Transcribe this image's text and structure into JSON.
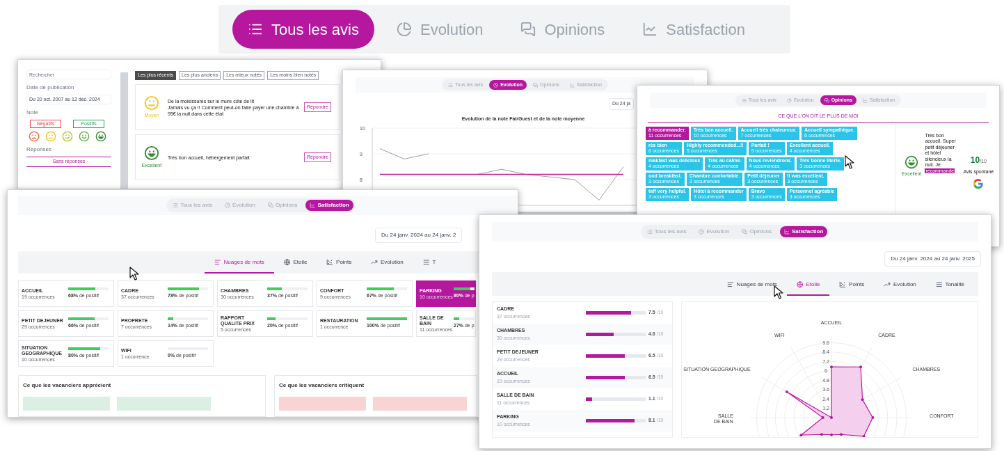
{
  "main_tabs": [
    {
      "label": "Tous les avis",
      "selected": true
    },
    {
      "label": "Evolution",
      "selected": false
    },
    {
      "label": "Opinions",
      "selected": false
    },
    {
      "label": "Satisfaction",
      "selected": false
    }
  ],
  "reviews_window": {
    "search": {
      "placeholder": "Rechercher"
    },
    "date_filter": {
      "label": "Date de publication",
      "value": "Du 20 oct. 2007 au 12 déc. 2024"
    },
    "note_filter": {
      "label": "Note",
      "buttons": [
        {
          "label": "Négatifs",
          "color": "#ef4444"
        },
        {
          "label": "Positifs",
          "color": "#22a55a"
        }
      ],
      "moods": [
        {
          "kind": "sad",
          "color": "#f26b3a"
        },
        {
          "kind": "neutral",
          "color": "#f5c518"
        },
        {
          "kind": "slight",
          "color": "#a8c62a"
        },
        {
          "kind": "smile",
          "color": "#5fae3c"
        },
        {
          "kind": "laugh",
          "color": "#2e8b2e"
        }
      ]
    },
    "responses_filter": {
      "label": "Réponses",
      "option": "Sans réponses"
    },
    "sort_buttons": [
      {
        "label": "Les plus récents",
        "selected": true
      },
      {
        "label": "Les plus anciens",
        "selected": false
      },
      {
        "label": "Les mieux notés",
        "selected": false
      },
      {
        "label": "Les moins bien notés",
        "selected": false
      }
    ],
    "reviews": [
      {
        "kind": "neutral",
        "color": "#f5c518",
        "rating": "Moyen",
        "text": "De la moisissures sur le mure côte de lit\nJamais vu ça !! Comment peut-on faire payer une chambre à 95€ la nuit dans cette état",
        "reply": "Répondre"
      },
      {
        "kind": "laugh",
        "color": "#2e8b2e",
        "rating": "Excellent",
        "text": "Très bon accueil, hébergement parfait",
        "reply": "Répondre"
      }
    ]
  },
  "evolution_window": {
    "tabs": [
      {
        "label": "Tous les avis",
        "selected": false
      },
      {
        "label": "Evolution",
        "selected": true
      },
      {
        "label": "Opinions",
        "selected": false
      },
      {
        "label": "Satisfaction",
        "selected": false
      }
    ],
    "date": "Du 24 ja",
    "chart_data": {
      "type": "line",
      "title": "Evolution de la note FairGuest et de la note moyenne",
      "ylim": [
        7,
        10
      ],
      "yticks": [
        8,
        9,
        10
      ],
      "series": [
        {
          "color": "#9e9e9e",
          "values": [
            9.2,
            8.8,
            9,
            null,
            8.2,
            8.4,
            8.2,
            8.1,
            8.0,
            7.2,
            8.5
          ]
        },
        {
          "color": "#c2189f",
          "values": [
            8.2,
            8.2,
            8.2,
            8.2,
            8.2,
            8.2,
            8.2,
            8.2,
            8.2,
            8.2,
            8.2
          ]
        }
      ]
    }
  },
  "opinions_window": {
    "tabs": [
      {
        "label": "Tous les avis",
        "selected": false
      },
      {
        "label": "Evolution",
        "selected": false
      },
      {
        "label": "Opinions",
        "selected": true
      },
      {
        "label": "Satisfaction",
        "selected": false
      }
    ],
    "heading": "CE QUE L'ON DIT LE PLUS DE MOI",
    "tag_rows": [
      [
        {
          "label": "à recommander.",
          "count": "11 occurrences",
          "selected": true
        },
        {
          "label": "Très bon accueil.",
          "count": "10 occurrences",
          "selected": false
        },
        {
          "label": "Accueil très chaleureux.",
          "count": "7 occurrences",
          "selected": false
        },
        {
          "label": "Accueil sympathique.",
          "count": "6 occurrences",
          "selected": false
        }
      ],
      [
        {
          "label": "rès bien",
          "count": "6 occurrences",
          "selected": false
        },
        {
          "label": "Highly recommended...!!",
          "count": "5 occurrences",
          "selected": false
        },
        {
          "label": "Parfait !",
          "count": "5 occurrences",
          "selected": false
        },
        {
          "label": "Excellent accueil.",
          "count": "4 occurrences",
          "selected": false
        }
      ],
      [
        {
          "label": "reakfast was delicious",
          "count": "4 occurrences",
          "selected": false
        },
        {
          "label": "Très au calme.",
          "count": "4 occurrences",
          "selected": false
        },
        {
          "label": "Nous reviendrons.",
          "count": "4 occurrences",
          "selected": false
        },
        {
          "label": "Très bonne literie.",
          "count": "3 occurrences",
          "selected": false
        }
      ],
      [
        {
          "label": "ood breakfast.",
          "count": "3 occurrences",
          "selected": false
        },
        {
          "label": "Chambre confortable.",
          "count": "3 occurrences",
          "selected": false
        },
        {
          "label": "Petit déjeuner",
          "count": "3 occurrences",
          "selected": false
        },
        {
          "label": "It was excellent.",
          "count": "3 occurrences",
          "selected": false
        }
      ],
      [
        {
          "label": "taff very helpful.",
          "count": "3 occurrences",
          "selected": false
        },
        {
          "label": "Hôtel à recommander",
          "count": "3 occurrences",
          "selected": false
        },
        {
          "label": "Bravo",
          "count": "3 occurrences",
          "selected": false
        },
        {
          "label": "Personnel agréable",
          "count": "3 occurrences",
          "selected": false
        }
      ]
    ],
    "review": {
      "kind": "laugh",
      "color": "#2e8b2e",
      "rating": "Excellent",
      "text": "Tres bon accueil. Super petit déjeuner et hôtel silencieux la nuit. Je",
      "highlight": "recommande",
      "score": "10",
      "scale": "/10",
      "source_label": "Avis spontané"
    }
  },
  "satisfaction_words_window": {
    "tabs": [
      {
        "label": "Tous les avis",
        "selected": false
      },
      {
        "label": "Evolution",
        "selected": false
      },
      {
        "label": "Opinions",
        "selected": false
      },
      {
        "label": "Satisfaction",
        "selected": true
      }
    ],
    "date": "Du 24 janv. 2024 au 24 janv. 2",
    "subtabs": [
      {
        "label": "Nuages de mots",
        "selected": true
      },
      {
        "label": "Etoile",
        "selected": false
      },
      {
        "label": "Points",
        "selected": false
      },
      {
        "label": "Evolution",
        "selected": false
      },
      {
        "label": "T",
        "selected": false
      }
    ],
    "categories": [
      {
        "name": "ACCUEIL",
        "count": "19 occurrences",
        "level": 0.68,
        "positive": "**68%** de positif",
        "selected": false
      },
      {
        "name": "CADRE",
        "count": "37 occurrences",
        "level": 0.78,
        "positive": "**78%** de positif",
        "selected": false
      },
      {
        "name": "CHAMBRES",
        "count": "30 occurrences",
        "level": 0.37,
        "positive": "**37%** de positif",
        "selected": false
      },
      {
        "name": "CONFORT",
        "count": "9 occurrences",
        "level": 0.67,
        "positive": "**67%** de positif",
        "selected": false
      },
      {
        "name": "PARKING",
        "count": "10 occurrences",
        "level": 0.8,
        "positive": "**80%** de p",
        "selected": true
      },
      {
        "name": "PETIT DEJEUNER",
        "count": "29 occurrences",
        "level": 0.66,
        "positive": "**66%** de positif",
        "selected": false
      },
      {
        "name": "PROPRETE",
        "count": "7 occurrences",
        "level": 0.14,
        "positive": "**14%** de positif",
        "selected": false
      },
      {
        "name": "RAPPORT QUALITE PRIX",
        "count": "5 occurrences",
        "level": 0.2,
        "positive": "**20%** de positif",
        "selected": false
      },
      {
        "name": "RESTAURATION",
        "count": "1 occurrence",
        "level": 1,
        "positive": "**100%** de positif",
        "selected": false
      },
      {
        "name": "SALLE DE BAIN",
        "count": "11 occurrences",
        "level": 0.27,
        "positive": "**27%** de p",
        "selected": false
      },
      {
        "name": "SITUATION GEOGRAPHIQUE",
        "count": "10 occurrences",
        "level": 0.8,
        "positive": "**80%** de positif",
        "selected": false
      },
      {
        "name": "WIFI",
        "count": "1 occurrence",
        "level": 0,
        "positive": "**0%** de positif",
        "selected": false
      }
    ],
    "sections": [
      {
        "title": "Ce que les vacanciers apprécient",
        "kind": "positive"
      },
      {
        "title": "Ce que les vacanciers critiquent",
        "kind": "negative"
      }
    ]
  },
  "satisfaction_star_window": {
    "tabs": [
      {
        "label": "Tous les avis",
        "selected": false
      },
      {
        "label": "Evolution",
        "selected": false
      },
      {
        "label": "Opinions",
        "selected": false
      },
      {
        "label": "Satisfaction",
        "selected": true
      }
    ],
    "date": "Du 24 janv. 2024 au 24 janv. 2025",
    "subtabs": [
      {
        "label": "Nuages de mots",
        "selected": false
      },
      {
        "label": "Etoile",
        "selected": true
      },
      {
        "label": "Points",
        "selected": false
      },
      {
        "label": "Evolution",
        "selected": false
      },
      {
        "label": "Tonalité",
        "selected": false
      }
    ],
    "scores": [
      {
        "name": "CADRE",
        "count": "37 occurrences",
        "level": 0.75,
        "score": "7.5",
        "scale": "/10"
      },
      {
        "name": "CHAMBRES",
        "count": "30 occurrences",
        "level": 0.46,
        "score": "4.6",
        "scale": "/10"
      },
      {
        "name": "PETIT DEJEUNER",
        "count": "29 occurrences",
        "level": 0.65,
        "score": "6.5",
        "scale": "/10"
      },
      {
        "name": "ACCUEIL",
        "count": "19 occurrences",
        "level": 0.65,
        "score": "6.5",
        "scale": "/10"
      },
      {
        "name": "SALLE DE BAIN",
        "count": "11 occurrences",
        "level": 0.11,
        "score": "1.1",
        "scale": "/10"
      },
      {
        "name": "PARKING",
        "count": "10 occurrences",
        "level": 0.81,
        "score": "8.1",
        "scale": "/10"
      }
    ],
    "radar": {
      "axes": [
        "ACCUEIL",
        "WIFI",
        "CADRE",
        "SITUATION GEOGRAPHIQUE",
        "CHAMBRES",
        "SALLE DE BAIN",
        "CONFORT"
      ],
      "ticks": [
        "9.6",
        "8.4",
        "7.2",
        "6",
        "4.8",
        "3.6",
        "2.4",
        "1.2"
      ]
    }
  }
}
